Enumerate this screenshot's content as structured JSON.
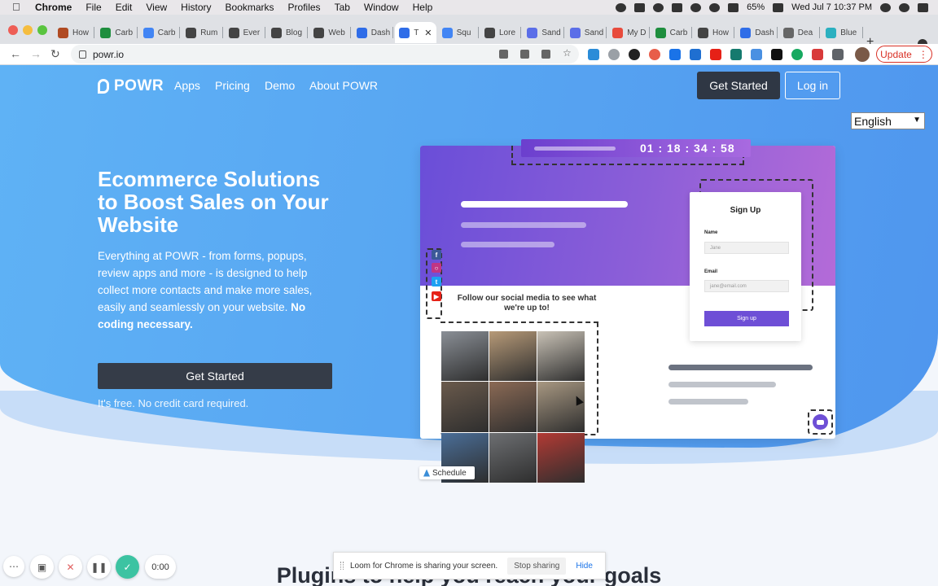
{
  "menubar": {
    "app": "Chrome",
    "items": [
      "File",
      "Edit",
      "View",
      "History",
      "Bookmarks",
      "Profiles",
      "Tab",
      "Window",
      "Help"
    ],
    "battery": "65%",
    "datetime": "Wed Jul 7  10:37 PM"
  },
  "tabs": [
    {
      "label": "How",
      "color": "#b04a22"
    },
    {
      "label": "Carb",
      "color": "#1e8e3e"
    },
    {
      "label": "Carb",
      "color": "#4285f4"
    },
    {
      "label": "Rum",
      "color": "#444444"
    },
    {
      "label": "Ever",
      "color": "#444444"
    },
    {
      "label": "Blog",
      "color": "#444444"
    },
    {
      "label": "Web",
      "color": "#444444"
    },
    {
      "label": "Dash",
      "color": "#2f6de8"
    },
    {
      "label": "T",
      "color": "#2f6de8",
      "active": true
    },
    {
      "label": "Squ",
      "color": "#4285f4"
    },
    {
      "label": "Lore",
      "color": "#444444"
    },
    {
      "label": "Sand",
      "color": "#5b6ee8"
    },
    {
      "label": "Sand",
      "color": "#5b6ee8"
    },
    {
      "label": "My D",
      "color": "#e84b3c"
    },
    {
      "label": "Carb",
      "color": "#1e8e3e"
    },
    {
      "label": "How",
      "color": "#444444"
    },
    {
      "label": "Dash",
      "color": "#2f6de8"
    },
    {
      "label": "Dea",
      "color": "#666666"
    },
    {
      "label": "Blue",
      "color": "#2bb0c0"
    }
  ],
  "toolbar": {
    "url": "powr.io",
    "update_label": "Update"
  },
  "site": {
    "logo": "POWR",
    "nav": [
      "Apps",
      "Pricing",
      "Demo",
      "About POWR"
    ],
    "get_started": "Get Started",
    "login": "Log in",
    "language": "English",
    "headline": "Ecommerce Solutions to Boost Sales on Your Website",
    "subcopy": "Everything at POWR - from forms, popups, review apps and more - is designed to help collect more contacts and make more sales, easily and seamlessly on your website.",
    "subcopy_bold": "No coding necessary.",
    "hero_cta": "Get Started",
    "free_note": "It's free. No credit card required.",
    "plugins_heading": "Plugins to help you reach your goals"
  },
  "mockup": {
    "timer": "01 : 18 : 34 : 58",
    "signup_title": "Sign Up",
    "name_label": "Name",
    "name_placeholder": "Jane",
    "email_label": "Email",
    "email_placeholder": "jane@email.com",
    "signup_button": "Sign up",
    "follow_text": "Follow our social media to see what we're up to!",
    "schedule_tag": "Schedule",
    "photo_colors": [
      "#8a8f96",
      "#b79a78",
      "#c9c2b6",
      "#6a5a4c",
      "#8b6a55",
      "#a89882",
      "#4a6e98",
      "#6d6f72",
      "#b23a34"
    ]
  },
  "loom": {
    "timer": "0:00",
    "share_message": "Loom for Chrome is sharing your screen.",
    "stop_label": "Stop sharing",
    "hide_label": "Hide"
  }
}
